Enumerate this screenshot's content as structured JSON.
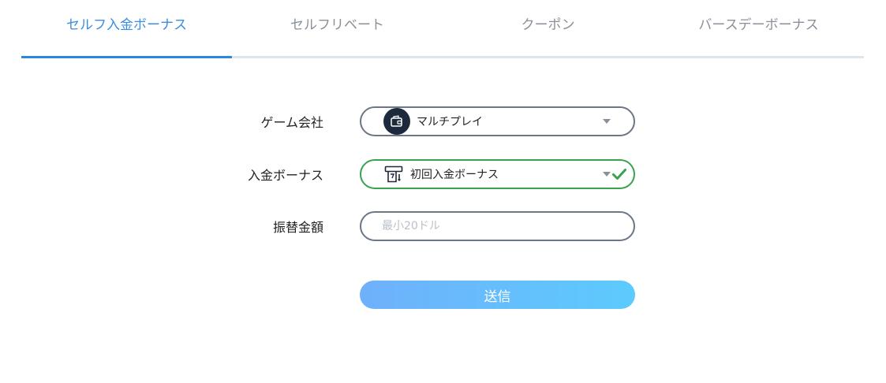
{
  "tabs": [
    {
      "label": "セルフ入金ボーナス",
      "active": true
    },
    {
      "label": "セルフリベート",
      "active": false
    },
    {
      "label": "クーポン",
      "active": false
    },
    {
      "label": "バースデーボーナス",
      "active": false
    }
  ],
  "form": {
    "game_company": {
      "label": "ゲーム会社",
      "value": "マルチプレイ",
      "icon": "wallet-icon"
    },
    "deposit_bonus": {
      "label": "入金ボーナス",
      "value": "初回入金ボーナス",
      "icon": "atm-icon",
      "status_icon": "check-icon"
    },
    "transfer_amount": {
      "label": "振替金額",
      "value": "",
      "placeholder": "最小20ドル"
    },
    "submit_label": "送信"
  },
  "colors": {
    "accent": "#2f86e0",
    "valid": "#3aa14f",
    "button_gradient_start": "#6fb0fb",
    "button_gradient_end": "#5ccbfd"
  }
}
